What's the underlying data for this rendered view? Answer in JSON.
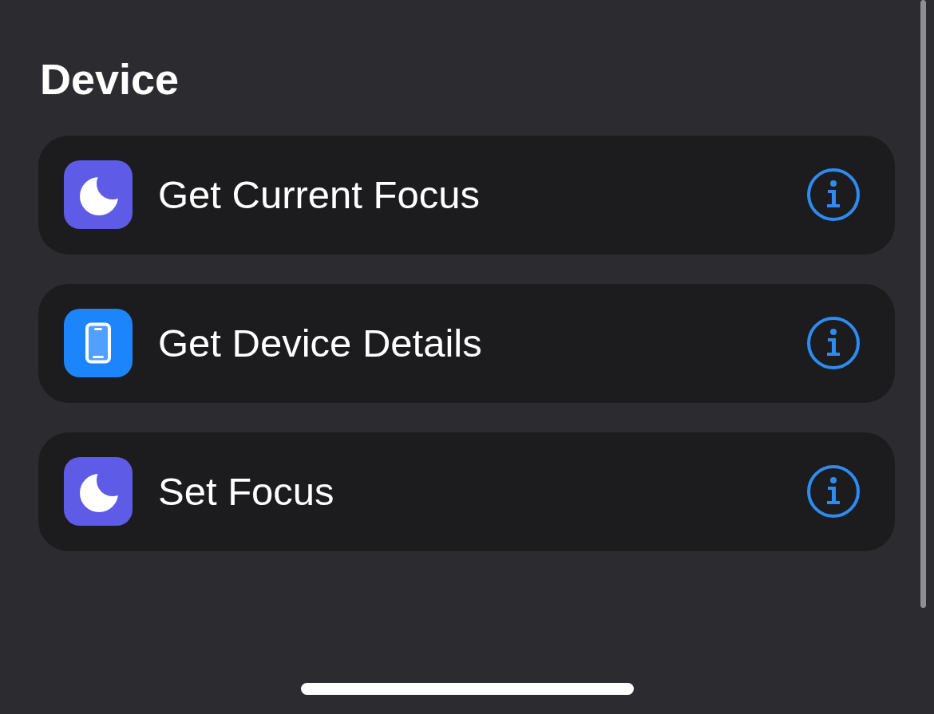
{
  "section": {
    "title": "Device"
  },
  "actions": [
    {
      "name": "Get Current Focus",
      "kind": "moon"
    },
    {
      "name": "Get Device Details",
      "kind": "phone"
    },
    {
      "name": "Set Focus",
      "kind": "moon"
    }
  ]
}
